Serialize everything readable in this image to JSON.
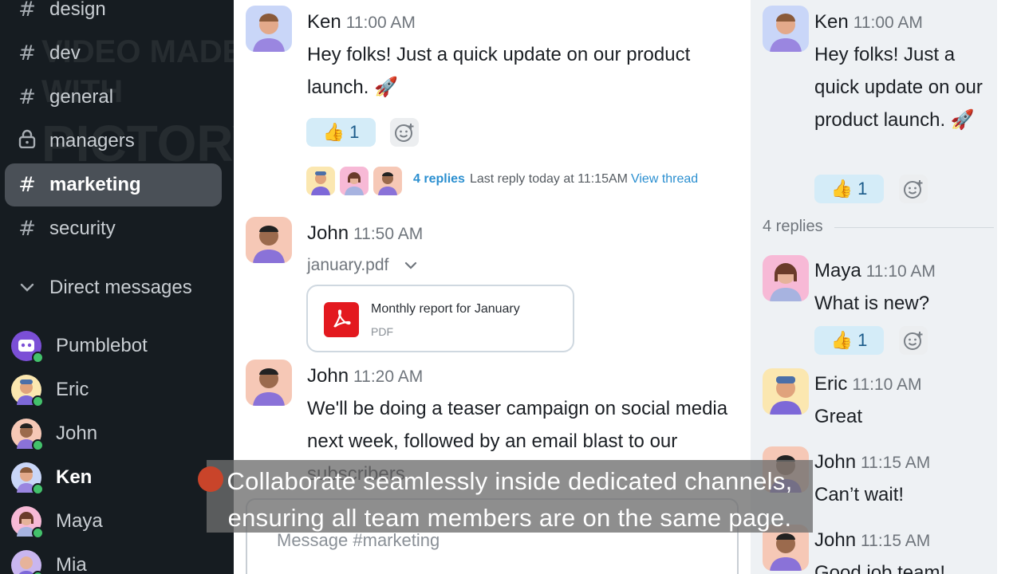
{
  "sidebar": {
    "channels": [
      {
        "label": "design",
        "icon": "hash-icon"
      },
      {
        "label": "dev",
        "icon": "hash-icon"
      },
      {
        "label": "general",
        "icon": "hash-icon"
      },
      {
        "label": "managers",
        "icon": "lock-icon"
      },
      {
        "label": "marketing",
        "icon": "hash-icon",
        "active": true
      },
      {
        "label": "security",
        "icon": "hash-icon"
      }
    ],
    "dm_header": "Direct messages",
    "dms": [
      {
        "label": "Pumblebot"
      },
      {
        "label": "Eric"
      },
      {
        "label": "John"
      },
      {
        "label": "Ken",
        "bold": true
      },
      {
        "label": "Maya"
      },
      {
        "label": "Mia"
      }
    ],
    "watermark_line1": "VIDEO MADE WITH",
    "watermark_line2": "PICTORY.AI"
  },
  "main": {
    "messages": [
      {
        "name": "Ken",
        "time": "11:00 AM",
        "text": "Hey folks! Just a quick update on our product launch. 🚀",
        "reaction": {
          "emoji": "👍",
          "count": "1"
        },
        "thread": {
          "replies": "4 replies",
          "last_reply": "Last reply today at 11:15AM",
          "view": "View thread"
        }
      },
      {
        "name": "John",
        "time": "11:50 AM",
        "file_name": "january.pdf",
        "file_title": "Monthly report for January",
        "file_type": "PDF"
      },
      {
        "name": "John",
        "time": "11:20 AM",
        "text": "We'll be doing a teaser campaign on social media next week, followed by an email blast to our subscribers."
      }
    ],
    "composer_placeholder": "Message #marketing"
  },
  "thread": {
    "parent": {
      "name": "Ken",
      "time": "11:00 AM",
      "text": "Hey folks! Just a quick update on our product launch. 🚀",
      "reaction": {
        "emoji": "👍",
        "count": "1"
      }
    },
    "replies_label": "4 replies",
    "replies": [
      {
        "name": "Maya",
        "time": "11:10 AM",
        "text": "What is new?",
        "reaction": {
          "emoji": "👍",
          "count": "1"
        }
      },
      {
        "name": "Eric",
        "time": "11:10 AM",
        "text": "Great"
      },
      {
        "name": "John",
        "time": "11:15 AM",
        "text": "Can’t wait!"
      },
      {
        "name": "John",
        "time": "11:15 AM",
        "text": "Good job team!"
      }
    ]
  },
  "caption": {
    "line1": "Collaborate seamlessly inside dedicated channels,",
    "line2": "ensuring all team members are on the same page."
  },
  "colors": {
    "sidebar_bg": "#161c21",
    "active_channel": "#4a5057",
    "link_blue": "#2b8fd0",
    "reaction_bg": "#d4ecf8",
    "online_green": "#43c16b",
    "pdf_red": "#e3191f"
  }
}
